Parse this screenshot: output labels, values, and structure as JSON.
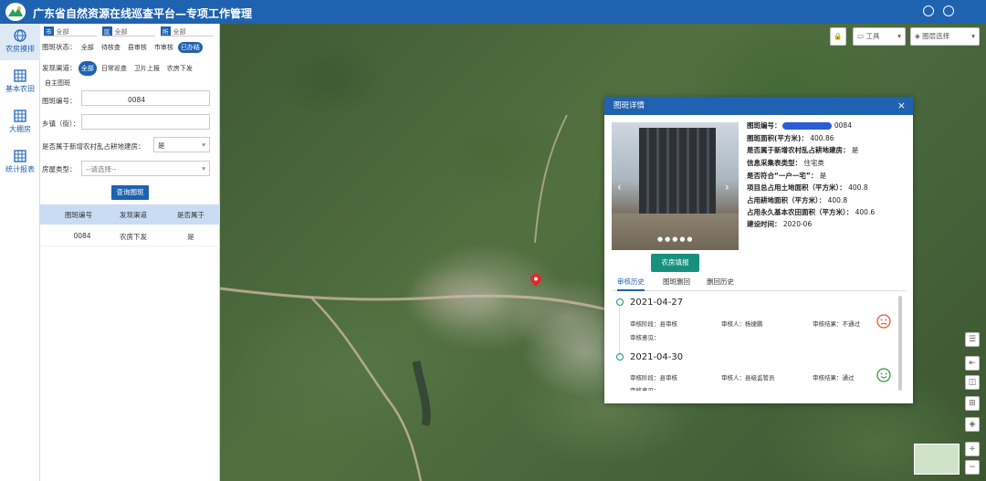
{
  "app": {
    "title": "广东省自然资源在线巡查平台—专项工作管理"
  },
  "nav": [
    {
      "label": "农房摸排",
      "icon": "globe-icon",
      "active": true
    },
    {
      "label": "基本农田",
      "icon": "grid-icon"
    },
    {
      "label": "大棚房",
      "icon": "grid-icon"
    },
    {
      "label": "统计报表",
      "icon": "grid-icon"
    }
  ],
  "filters": {
    "region": [
      {
        "tag": "市",
        "value": "全部"
      },
      {
        "tag": "区",
        "value": "全部"
      },
      {
        "tag": "所",
        "value": "全部"
      }
    ],
    "status_label": "图斑状态：",
    "status_options": [
      "全部",
      "待核查",
      "县审核",
      "市审核",
      "已办结"
    ],
    "status_active": "已办结",
    "channel_label": "发现渠道：",
    "channel_options": [
      "全部",
      "日常巡查",
      "卫片上报",
      "农房下发",
      "自主图斑"
    ],
    "channel_active": "全部",
    "code_label": "图斑编号：",
    "code_value": "0084",
    "town_label": "乡镇（街）：",
    "town_value": "",
    "farmland_label": "是否属于新增农村乱占耕地建房：",
    "farmland_value": "是",
    "house_label": "房屋类型：",
    "house_placeholder": "--请选择--",
    "query_button": "查询图斑"
  },
  "table": {
    "headers": [
      "图斑编号",
      "发现渠道",
      "是否属于"
    ],
    "rows": [
      [
        "0084",
        "农房下发",
        "是"
      ]
    ]
  },
  "map_controls": {
    "tool": "工具",
    "layers": "图层选择"
  },
  "dialog": {
    "title": "图斑详情",
    "close": "×",
    "fill_button": "农房填报",
    "info": [
      {
        "label": "图斑编号：",
        "value": "0084"
      },
      {
        "label": "图斑面积(平方米)：",
        "value": "400.86"
      },
      {
        "label": "是否属于新增农村乱占耕地建房：",
        "value": "是"
      },
      {
        "label": "信息采集表类型：",
        "value": "住宅类"
      },
      {
        "label": "是否符合“一户一宅”：",
        "value": "是"
      },
      {
        "label": "项目总占用土地面积（平方米）：",
        "value": "400.8"
      },
      {
        "label": "占用耕地面积（平方米）：",
        "value": "400.8"
      },
      {
        "label": "占用永久基本农田面积（平方米）：",
        "value": "400.6"
      },
      {
        "label": "建设时间：",
        "value": "2020-06"
      }
    ],
    "tabs": [
      "审核历史",
      "图斑删回",
      "删回历史"
    ],
    "records": [
      {
        "date": "2021-04-27",
        "stage_label": "审核阶段：",
        "stage": "县审核",
        "auditor_label": "审核人：",
        "auditor": "杨捷鹏",
        "result_label": "审核结果：",
        "result": "不通过",
        "opinion_label": "审核意见：",
        "face": "sad-face-icon"
      },
      {
        "date": "2021-04-30",
        "stage_label": "审核阶段：",
        "stage": "县审核",
        "auditor_label": "审核人：",
        "auditor": "县级监管员",
        "result_label": "审核结果：",
        "result": "通过",
        "opinion_label": "审核意见：",
        "face": "happy-face-icon"
      }
    ]
  },
  "colors": {
    "primary": "#1f62b0",
    "teal": "#16917d",
    "fail": "#e4572e",
    "pass": "#2e9a3c"
  }
}
